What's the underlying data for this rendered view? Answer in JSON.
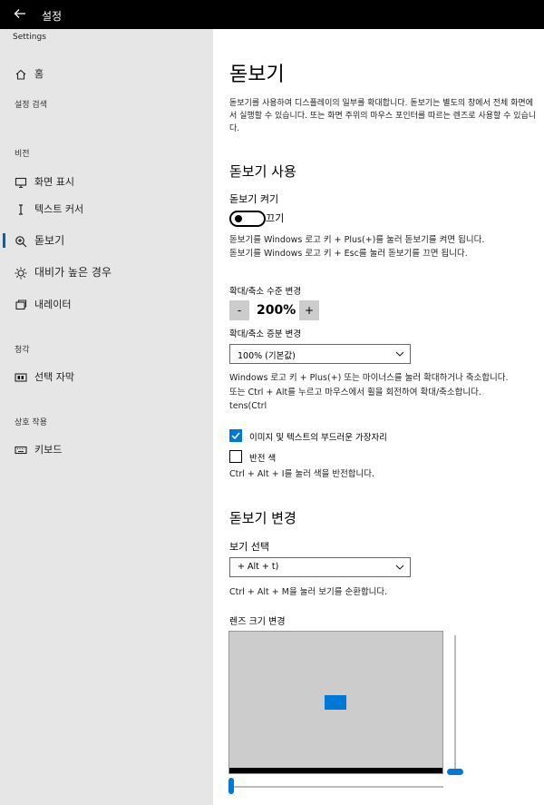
{
  "titlebar": {
    "title": "설정"
  },
  "sidebar": {
    "app_name": "Settings",
    "home_label": "홈",
    "search_placeholder": "설정 검색",
    "section_vision": "비전",
    "section_hearing": "청각",
    "section_interaction": "상호 작용",
    "items": [
      {
        "label": "화면 표시"
      },
      {
        "label": "텍스트 커서"
      },
      {
        "label": "돋보기"
      },
      {
        "label": "대비가 높은 경우"
      },
      {
        "label": "내레이터"
      },
      {
        "label": "선택 자막"
      },
      {
        "label": "키보드"
      }
    ]
  },
  "main": {
    "title": "돋보기",
    "description": "돋보기를 사용하여 디스플레이의 일부를 확대합니다. 돋보기는 별도의 창에서 전체 화면에서 실행할 수 있습니다. 또는 화면 주위의 마우스 포인터를 따르는 렌즈로 사용할 수 있습니다.",
    "use_heading": "돋보기 사용",
    "toggle_label": "돋보기 켜기",
    "toggle_state": "끄기",
    "shortcut_on": "돋보기를 Windows 로고 키 + Plus(+)를 눌러 돋보기를 켜면 됩니다.",
    "shortcut_off": "돋보기를 Windows 로고 키 + Esc를 눌러 돋보기를 끄면 됩니다.",
    "zoom_level_label": "확대/축소 수준 변경",
    "zoom_minus": "-",
    "zoom_value": "200%",
    "zoom_plus": "+",
    "increment_label": "확대/축소 증분 변경",
    "increment_value": "100% (기본값)",
    "wheel_info_1": "Windows 로고 키 + Plus(+) 또는 마이너스를 눌러 확대하거나 축소합니다.",
    "wheel_info_2": "또는 Ctrl + Alt를 누르고 마우스에서 휠을 회전하여 확대/축소합니다.",
    "wheel_info_3": "tens(Ctrl",
    "smooth_label": "이미지 및 텍스트의 부드러운 가장자리",
    "smooth_checked": true,
    "invert_label": "반전 색",
    "invert_checked": false,
    "invert_hint": "Ctrl + Alt + I를 눌러 색을 반전합니다.",
    "change_heading": "돋보기 변경",
    "view_label": "보기 선택",
    "view_value": "+ Alt + t)",
    "view_hint": "Ctrl + Alt + M을 눌러 보기를 순환합니다.",
    "lens_label": "렌즈 크기 변경",
    "accent": "#0078d7"
  }
}
